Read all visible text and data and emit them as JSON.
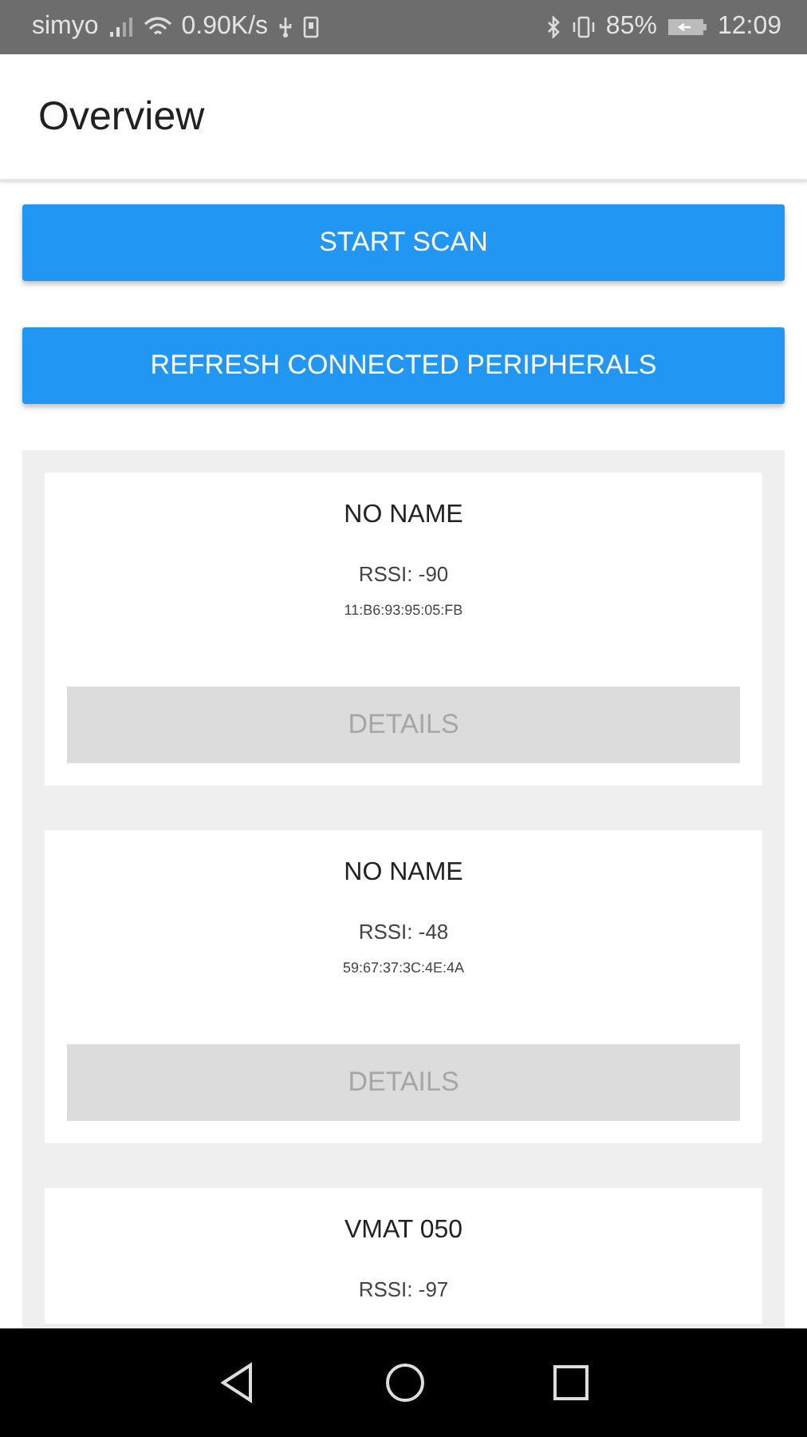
{
  "status_bar": {
    "carrier": "simyo",
    "speed": "0.90K/s",
    "battery": "85%",
    "time": "12:09"
  },
  "app_bar": {
    "title": "Overview"
  },
  "buttons": [
    {
      "label": "START SCAN"
    },
    {
      "label": "REFRESH CONNECTED PERIPHERALS"
    }
  ],
  "devices": [
    {
      "name": "NO NAME",
      "rssi": "RSSI: -90",
      "address": "11:B6:93:95:05:FB",
      "button": "DETAILS",
      "disabled": true
    },
    {
      "name": "NO NAME",
      "rssi": "RSSI: -48",
      "address": "59:67:37:3C:4E:4A",
      "button": "DETAILS",
      "disabled": true
    },
    {
      "name": "VMAT 050",
      "rssi": "RSSI: -97"
    }
  ]
}
